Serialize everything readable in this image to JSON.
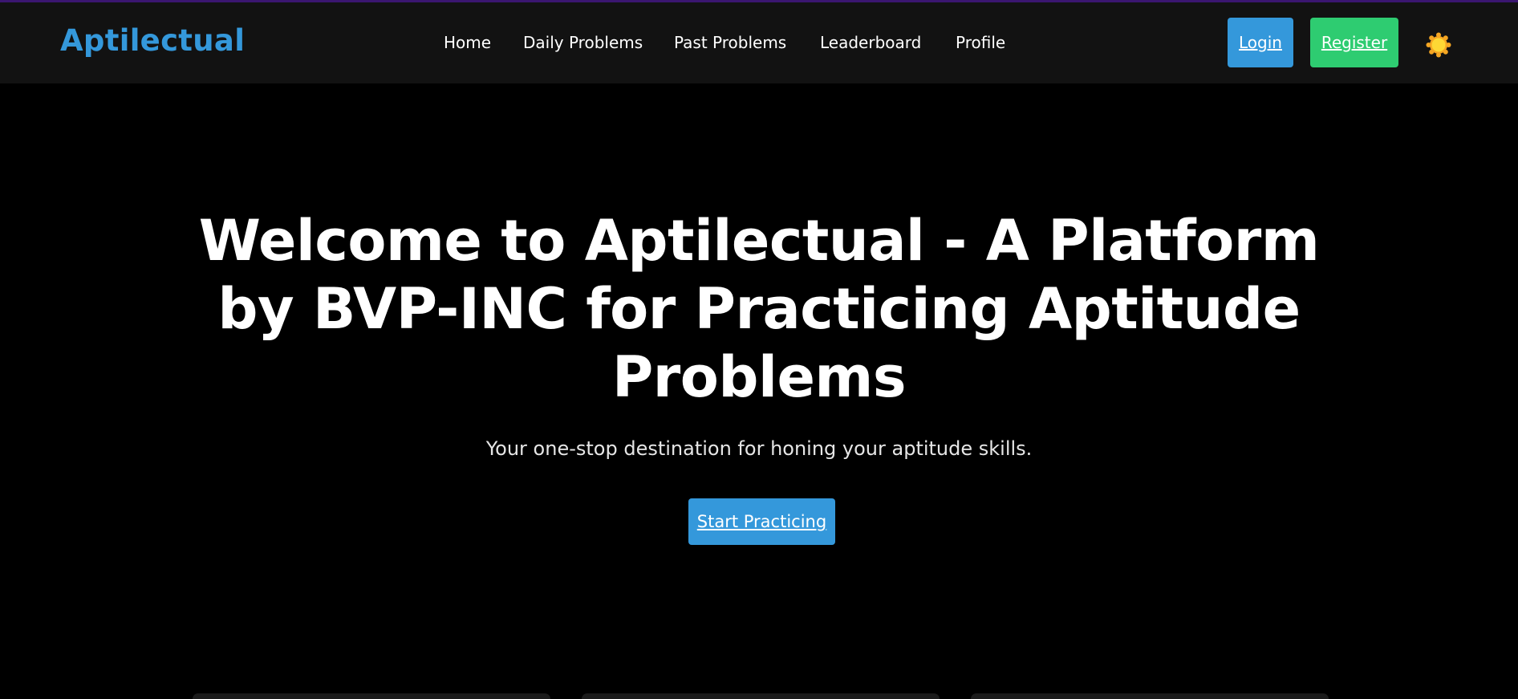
{
  "nav": {
    "brand": "Aptilectual",
    "links": [
      "Home",
      "Daily Problems",
      "Past Problems",
      "Leaderboard",
      "Profile"
    ],
    "login_label": "Login",
    "register_label": "Register",
    "theme_icon": "sun-icon"
  },
  "hero": {
    "title": "Welcome to Aptilectual - A Platform by BVP-INC for Practicing Aptitude Problems",
    "subtitle": "Your one-stop destination for honing your aptitude skills.",
    "cta_label": "Start Practicing"
  },
  "colors": {
    "accent": "#3498db",
    "register": "#2ecc71",
    "navbar_bg": "#121212",
    "page_bg": "#000000",
    "sun": "#f5a623"
  }
}
